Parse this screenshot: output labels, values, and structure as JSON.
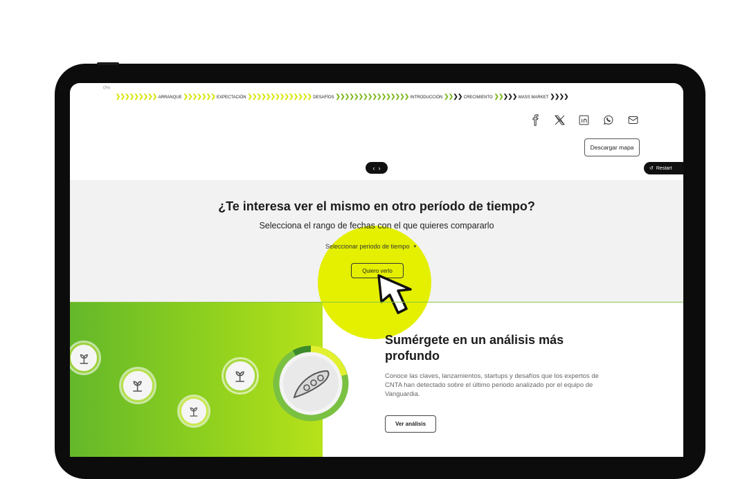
{
  "progress": {
    "zero_label": "0%",
    "stages": [
      "ARRANQUE",
      "EXPECTACIÓN",
      "DESAFÍOS",
      "INTRODUCCIÓN",
      "CRECIMIENTO",
      "MASS MARKET"
    ]
  },
  "share": {
    "icons": [
      "facebook-icon",
      "x-icon",
      "linkedin-icon",
      "whatsapp-icon",
      "mail-icon"
    ]
  },
  "download_label": "Descargar mapa",
  "pager": {
    "prev": "‹",
    "next": "›"
  },
  "restart_label": "Restart",
  "compare": {
    "title": "¿Te interesa ver el mismo en otro período de tiempo?",
    "subtitle": "Selecciona el rango de fechas con el que quieres compararlo",
    "period_select": "Seleccionar periodo de tiempo",
    "cta": "Quiero verlo"
  },
  "deep": {
    "title": "Sumérgete en un análisis más profundo",
    "text": "Conoce las claves, lanzamientos, startups y desafíos que los expertos de CNTA han detectado sobre el último periodo analizado por el equipo de Vanguardia.",
    "cta": "Ver análisis"
  },
  "colors": {
    "accent": "#e4f000",
    "green": "#7ab71a",
    "dark": "#111111"
  }
}
